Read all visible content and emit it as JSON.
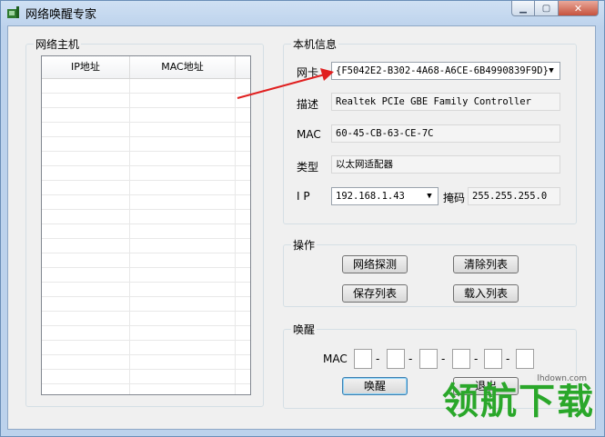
{
  "window": {
    "title": "网络唤醒专家"
  },
  "hosts": {
    "group_title": "网络主机",
    "columns": [
      "IP地址",
      "MAC地址"
    ]
  },
  "local_info": {
    "group_title": "本机信息",
    "nic_label": "网卡",
    "nic_value": "{F5042E2-B302-4A68-A6CE-6B4990839F9D}",
    "desc_label": "描述",
    "desc_value": "Realtek PCIe GBE Family Controller",
    "mac_label": "MAC",
    "mac_value": "60-45-CB-63-CE-7C",
    "type_label": "类型",
    "type_value": "以太网适配器",
    "ip_label": "I P",
    "ip_value": "192.168.1.43",
    "mask_label": "掩码",
    "mask_value": "255.255.255.0"
  },
  "operations": {
    "group_title": "操作",
    "probe_label": "网络探测",
    "clear_label": "清除列表",
    "save_label": "保存列表",
    "load_label": "载入列表"
  },
  "wake": {
    "group_title": "唤醒",
    "mac_label": "MAC",
    "mac_parts": [
      "",
      "",
      "",
      "",
      "",
      ""
    ],
    "wake_label": "唤醒",
    "exit_label": "退出"
  },
  "watermark": {
    "text": "领航下载",
    "site": "lhdown.com"
  },
  "colors": {
    "arrow": "#e02020",
    "watermark": "#2aa72a"
  }
}
